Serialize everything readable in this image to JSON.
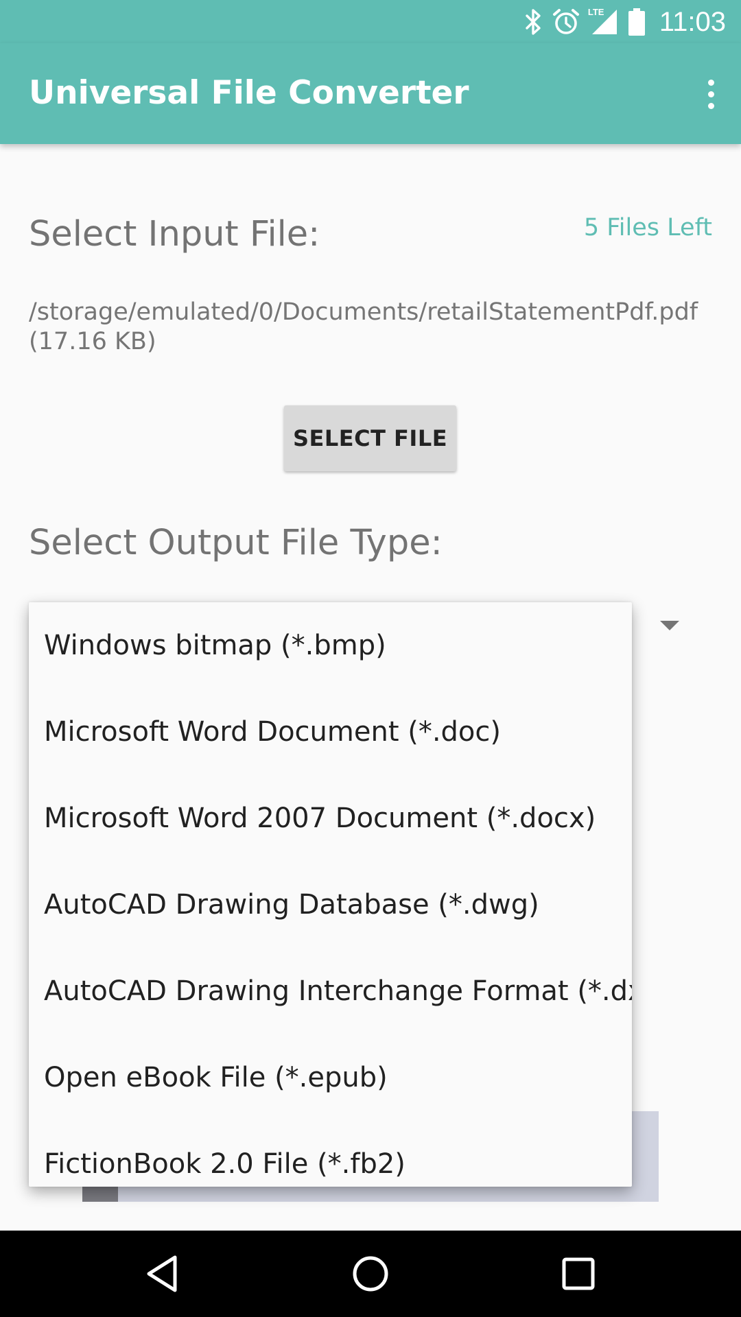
{
  "status_bar": {
    "time": "11:03",
    "network_label": "LTE",
    "icons": [
      "bluetooth-icon",
      "alarm-icon",
      "lte-signal-icon",
      "battery-icon"
    ],
    "color": "#5fbdb3"
  },
  "app_bar": {
    "title": "Universal File Converter",
    "menu_icon": "more-vert-icon",
    "color": "#5fbdb3"
  },
  "input": {
    "label": "Select Input File:",
    "files_left": "5 Files Left",
    "path": "/storage/emulated/0/Documents/retailStatementPdf.pdf",
    "size": "(17.16 KB)",
    "select_button": "SELECT FILE"
  },
  "output": {
    "label": "Select Output File Type:",
    "options": [
      "Windows bitmap (*.bmp)",
      "Microsoft Word Document (*.doc)",
      "Microsoft Word 2007 Document (*.docx)",
      "AutoCAD Drawing Database (*.dwg)",
      "AutoCAD Drawing Interchange Format (*.dxf)",
      "Open eBook File (*.epub)",
      "FictionBook 2.0 File (*.fb2)"
    ]
  },
  "nav": {
    "back_icon": "back-triangle-icon",
    "home_icon": "home-circle-icon",
    "recents_icon": "recents-square-icon"
  },
  "colors": {
    "accent": "#5fbdb3",
    "background": "#fafafa"
  }
}
